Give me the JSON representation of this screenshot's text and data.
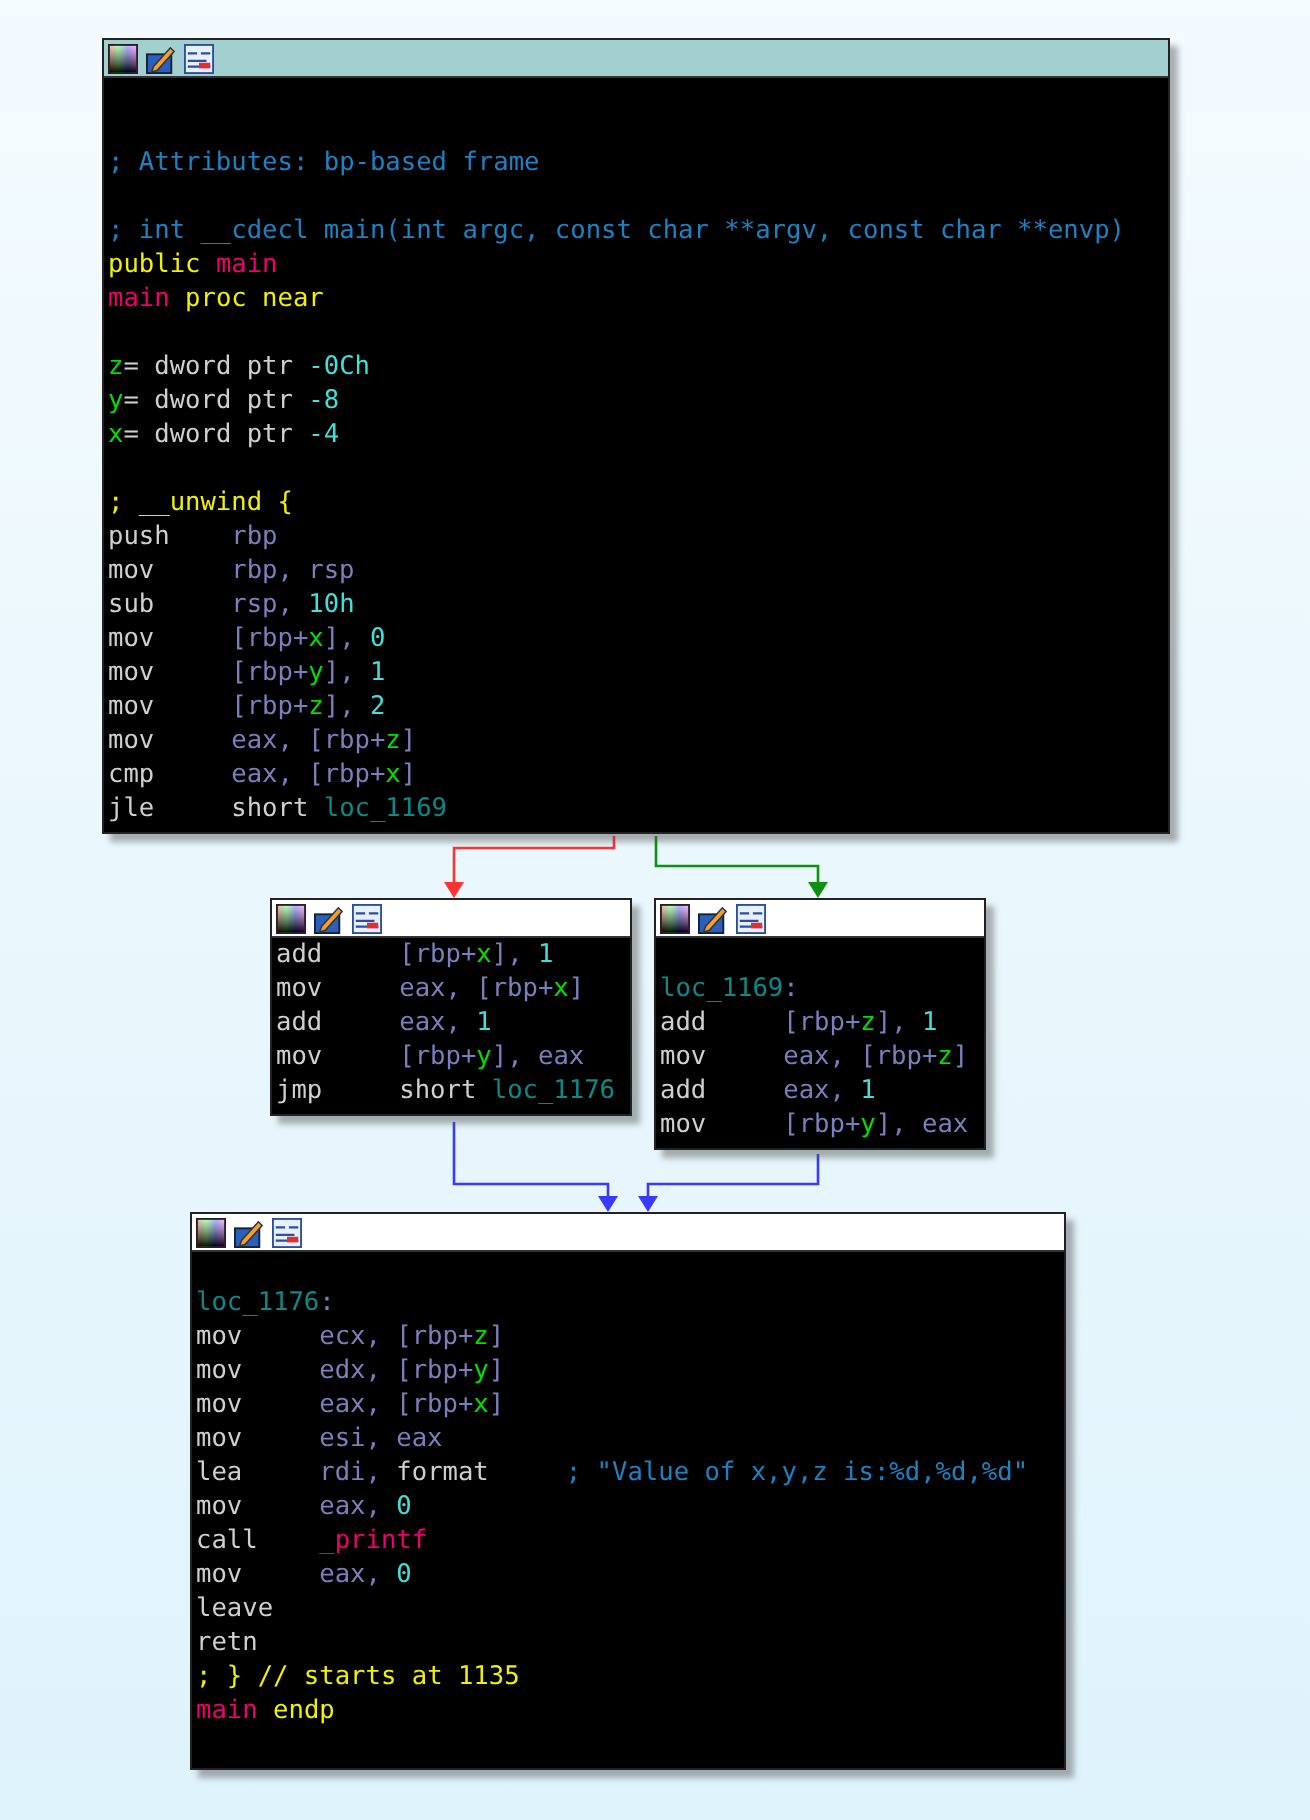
{
  "blocks": [
    {
      "selected": true,
      "lines": [
        {
          "kind": "blank"
        },
        {
          "kind": "blank"
        },
        {
          "kind": "text",
          "tokens": [
            {
              "t": "; Attributes: bp-based frame",
              "kind": "comment"
            }
          ]
        },
        {
          "kind": "blank"
        },
        {
          "kind": "text",
          "tokens": [
            {
              "t": "; int __cdecl main(int argc, const char **argv, const char **envp)",
              "kind": "comment"
            }
          ]
        },
        {
          "kind": "text",
          "tokens": [
            {
              "t": "public ",
              "kind": "keyword"
            },
            {
              "t": "main",
              "kind": "name"
            }
          ]
        },
        {
          "kind": "text",
          "tokens": [
            {
              "t": "main",
              "kind": "name"
            },
            {
              "t": " proc near",
              "kind": "keyword"
            }
          ]
        },
        {
          "kind": "blank"
        },
        {
          "kind": "text",
          "tokens": [
            {
              "t": "z",
              "kind": "var"
            },
            {
              "t": "= dword ptr ",
              "kind": "plain"
            },
            {
              "t": "-0Ch",
              "kind": "num"
            }
          ]
        },
        {
          "kind": "text",
          "tokens": [
            {
              "t": "y",
              "kind": "var"
            },
            {
              "t": "= dword ptr ",
              "kind": "plain"
            },
            {
              "t": "-8",
              "kind": "num"
            }
          ]
        },
        {
          "kind": "text",
          "tokens": [
            {
              "t": "x",
              "kind": "var"
            },
            {
              "t": "= dword ptr ",
              "kind": "plain"
            },
            {
              "t": "-4",
              "kind": "num"
            }
          ]
        },
        {
          "kind": "blank"
        },
        {
          "kind": "text",
          "tokens": [
            {
              "t": "; __unwind {",
              "kind": "keyword"
            }
          ]
        },
        {
          "kind": "instr",
          "op": "push",
          "args": [
            {
              "t": "rbp",
              "kind": "reg"
            }
          ]
        },
        {
          "kind": "instr",
          "op": "mov",
          "args": [
            {
              "t": "rbp, rsp",
              "kind": "reg"
            }
          ]
        },
        {
          "kind": "instr",
          "op": "sub",
          "args": [
            {
              "t": "rsp, ",
              "kind": "reg"
            },
            {
              "t": "10h",
              "kind": "num"
            }
          ]
        },
        {
          "kind": "instr",
          "op": "mov",
          "args": [
            {
              "t": "[rbp+",
              "kind": "reg"
            },
            {
              "t": "x",
              "kind": "var"
            },
            {
              "t": "], ",
              "kind": "reg"
            },
            {
              "t": "0",
              "kind": "num"
            }
          ]
        },
        {
          "kind": "instr",
          "op": "mov",
          "args": [
            {
              "t": "[rbp+",
              "kind": "reg"
            },
            {
              "t": "y",
              "kind": "var"
            },
            {
              "t": "], ",
              "kind": "reg"
            },
            {
              "t": "1",
              "kind": "num"
            }
          ]
        },
        {
          "kind": "instr",
          "op": "mov",
          "args": [
            {
              "t": "[rbp+",
              "kind": "reg"
            },
            {
              "t": "z",
              "kind": "var"
            },
            {
              "t": "], ",
              "kind": "reg"
            },
            {
              "t": "2",
              "kind": "num"
            }
          ]
        },
        {
          "kind": "instr",
          "op": "mov",
          "args": [
            {
              "t": "eax, [rbp+",
              "kind": "reg"
            },
            {
              "t": "z",
              "kind": "var"
            },
            {
              "t": "]",
              "kind": "reg"
            }
          ]
        },
        {
          "kind": "instr",
          "op": "cmp",
          "args": [
            {
              "t": "eax, [rbp+",
              "kind": "reg"
            },
            {
              "t": "x",
              "kind": "var"
            },
            {
              "t": "]",
              "kind": "reg"
            }
          ]
        },
        {
          "kind": "instr",
          "op": "jle",
          "args": [
            {
              "t": "short ",
              "kind": "plain"
            },
            {
              "t": "loc_1169",
              "kind": "label"
            }
          ]
        }
      ]
    },
    {
      "selected": false,
      "lines": [
        {
          "kind": "instr",
          "op": "add",
          "args": [
            {
              "t": "[rbp+",
              "kind": "reg"
            },
            {
              "t": "x",
              "kind": "var"
            },
            {
              "t": "], ",
              "kind": "reg"
            },
            {
              "t": "1",
              "kind": "num"
            }
          ]
        },
        {
          "kind": "instr",
          "op": "mov",
          "args": [
            {
              "t": "eax, [rbp+",
              "kind": "reg"
            },
            {
              "t": "x",
              "kind": "var"
            },
            {
              "t": "]",
              "kind": "reg"
            }
          ]
        },
        {
          "kind": "instr",
          "op": "add",
          "args": [
            {
              "t": "eax, ",
              "kind": "reg"
            },
            {
              "t": "1",
              "kind": "num"
            }
          ]
        },
        {
          "kind": "instr",
          "op": "mov",
          "args": [
            {
              "t": "[rbp+",
              "kind": "reg"
            },
            {
              "t": "y",
              "kind": "var"
            },
            {
              "t": "], eax",
              "kind": "reg"
            }
          ]
        },
        {
          "kind": "instr",
          "op": "jmp",
          "args": [
            {
              "t": "short ",
              "kind": "plain"
            },
            {
              "t": "loc_1176",
              "kind": "label"
            }
          ]
        }
      ]
    },
    {
      "selected": false,
      "lines": [
        {
          "kind": "blank"
        },
        {
          "kind": "text",
          "tokens": [
            {
              "t": "loc_1169",
              "kind": "label"
            },
            {
              "t": ":",
              "kind": "reg"
            }
          ]
        },
        {
          "kind": "instr",
          "op": "add",
          "args": [
            {
              "t": "[rbp+",
              "kind": "reg"
            },
            {
              "t": "z",
              "kind": "var"
            },
            {
              "t": "], ",
              "kind": "reg"
            },
            {
              "t": "1",
              "kind": "num"
            }
          ]
        },
        {
          "kind": "instr",
          "op": "mov",
          "args": [
            {
              "t": "eax, [rbp+",
              "kind": "reg"
            },
            {
              "t": "z",
              "kind": "var"
            },
            {
              "t": "]",
              "kind": "reg"
            }
          ]
        },
        {
          "kind": "instr",
          "op": "add",
          "args": [
            {
              "t": "eax, ",
              "kind": "reg"
            },
            {
              "t": "1",
              "kind": "num"
            }
          ]
        },
        {
          "kind": "instr",
          "op": "mov",
          "args": [
            {
              "t": "[rbp+",
              "kind": "reg"
            },
            {
              "t": "y",
              "kind": "var"
            },
            {
              "t": "], eax",
              "kind": "reg"
            }
          ]
        }
      ]
    },
    {
      "selected": false,
      "lines": [
        {
          "kind": "blank"
        },
        {
          "kind": "text",
          "tokens": [
            {
              "t": "loc_1176",
              "kind": "label"
            },
            {
              "t": ":",
              "kind": "reg"
            }
          ]
        },
        {
          "kind": "instr",
          "op": "mov",
          "args": [
            {
              "t": "ecx, [rbp+",
              "kind": "reg"
            },
            {
              "t": "z",
              "kind": "var"
            },
            {
              "t": "]",
              "kind": "reg"
            }
          ]
        },
        {
          "kind": "instr",
          "op": "mov",
          "args": [
            {
              "t": "edx, [rbp+",
              "kind": "reg"
            },
            {
              "t": "y",
              "kind": "var"
            },
            {
              "t": "]",
              "kind": "reg"
            }
          ]
        },
        {
          "kind": "instr",
          "op": "mov",
          "args": [
            {
              "t": "eax, [rbp+",
              "kind": "reg"
            },
            {
              "t": "x",
              "kind": "var"
            },
            {
              "t": "]",
              "kind": "reg"
            }
          ]
        },
        {
          "kind": "instr",
          "op": "mov",
          "args": [
            {
              "t": "esi, eax",
              "kind": "reg"
            }
          ]
        },
        {
          "kind": "instr",
          "op": "lea",
          "args": [
            {
              "t": "rdi, ",
              "kind": "reg"
            },
            {
              "t": "format",
              "kind": "plain"
            }
          ],
          "comment": "; \"Value of x,y,z is:%d,%d,%d\""
        },
        {
          "kind": "instr",
          "op": "mov",
          "args": [
            {
              "t": "eax, ",
              "kind": "reg"
            },
            {
              "t": "0",
              "kind": "num"
            }
          ]
        },
        {
          "kind": "instr",
          "op": "call",
          "args": [
            {
              "t": "_printf",
              "kind": "name"
            }
          ]
        },
        {
          "kind": "instr",
          "op": "mov",
          "args": [
            {
              "t": "eax, ",
              "kind": "reg"
            },
            {
              "t": "0",
              "kind": "num"
            }
          ]
        },
        {
          "kind": "text",
          "tokens": [
            {
              "t": "leave",
              "kind": "plain"
            }
          ]
        },
        {
          "kind": "text",
          "tokens": [
            {
              "t": "retn",
              "kind": "plain"
            }
          ]
        },
        {
          "kind": "text",
          "tokens": [
            {
              "t": "; } // starts at 1135",
              "kind": "keyword"
            }
          ]
        },
        {
          "kind": "text",
          "tokens": [
            {
              "t": "main",
              "kind": "name"
            },
            {
              "t": " endp",
              "kind": "keyword"
            }
          ]
        },
        {
          "kind": "blank"
        }
      ]
    }
  ],
  "edges": [
    {
      "color": "#ff3333"
    },
    {
      "color": "#109010"
    },
    {
      "color": "#3a3aff"
    },
    {
      "color": "#3a3aff"
    }
  ]
}
